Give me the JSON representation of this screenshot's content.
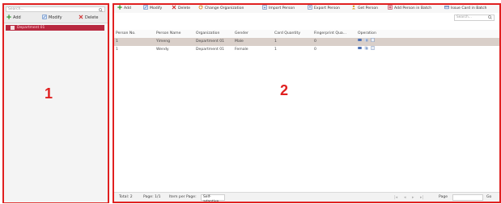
{
  "left_panel": {
    "search_placeholder": "Search...",
    "toolbar": {
      "add": "Add",
      "modify": "Modify",
      "delete": "Delete"
    },
    "organizations": [
      {
        "label": "Department 01"
      }
    ],
    "panel_label": "1"
  },
  "right_panel": {
    "toolbar": {
      "add": "Add",
      "modify": "Modify",
      "delete": "Delete",
      "change_org": "Change Organization",
      "import": "Import Person",
      "export": "Export Person",
      "get": "Get Person",
      "add_batch": "Add Person in Batch",
      "issue_batch": "Issue Card in Batch"
    },
    "search_placeholder": "Search...",
    "table": {
      "headers": [
        "Person No.",
        "Person Name",
        "Organization",
        "Gender",
        "Card Quantity",
        "Fingerprint Qua...",
        "Operation"
      ],
      "rows": [
        [
          "1",
          "Yimeng",
          "Department 01",
          "Male",
          "1",
          "0"
        ],
        [
          "1",
          "Wendy",
          "Department 01",
          "Female",
          "1",
          "0"
        ]
      ]
    },
    "panel_label": "2",
    "footer": {
      "total": "Total: 2",
      "page": "Page: 1/1",
      "per_page_label": "Item per Page:",
      "per_page_value": "Self-adaptive",
      "page_label": "Page",
      "go": "Go"
    }
  },
  "colors": {
    "highlight_border": "#e02020",
    "selected_org": "#b8283f",
    "selected_row": "#d9cfc9"
  }
}
